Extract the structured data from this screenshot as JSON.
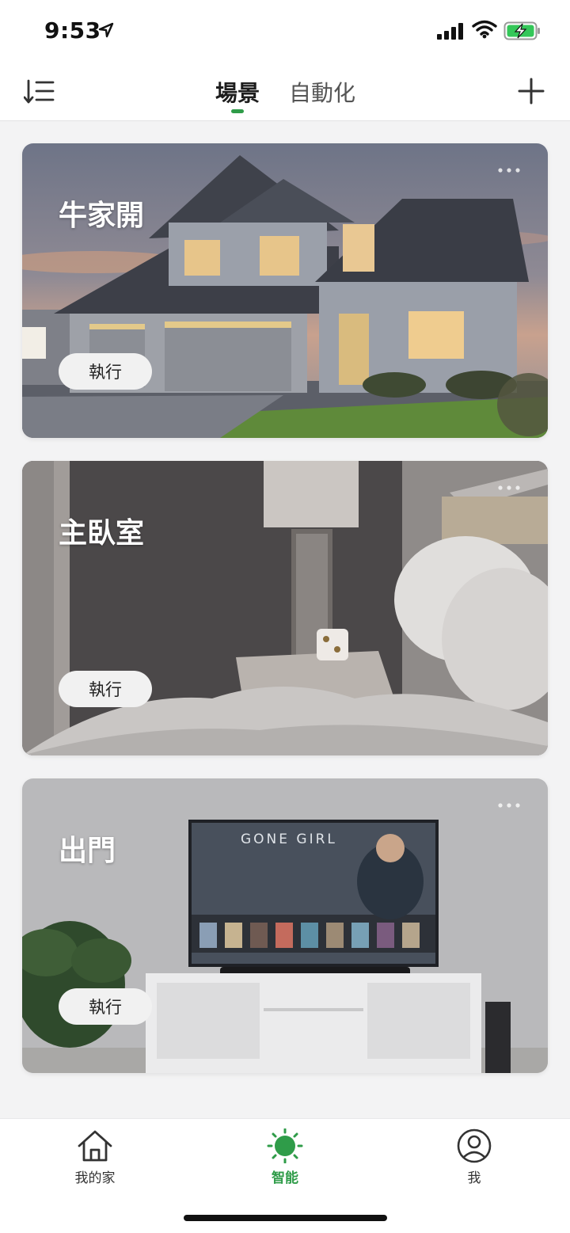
{
  "status_bar": {
    "time": "9:53"
  },
  "header": {
    "tabs": [
      {
        "label": "場景",
        "active": true
      },
      {
        "label": "自動化",
        "active": false
      }
    ]
  },
  "scenes": [
    {
      "title": "牛家開",
      "run_label": "執行",
      "image": "house-exterior"
    },
    {
      "title": "主臥室",
      "run_label": "執行",
      "image": "bedroom"
    },
    {
      "title": "出門",
      "run_label": "執行",
      "image": "living-room-tv",
      "tv_text": "GONE GIRL"
    }
  ],
  "bottom_nav": {
    "items": [
      {
        "label": "我的家",
        "icon": "home-icon"
      },
      {
        "label": "智能",
        "icon": "sun-icon",
        "active": true
      },
      {
        "label": "我",
        "icon": "person-icon"
      }
    ]
  },
  "colors": {
    "accent": "#2f9c49",
    "card_button": "#f1f1f1"
  }
}
